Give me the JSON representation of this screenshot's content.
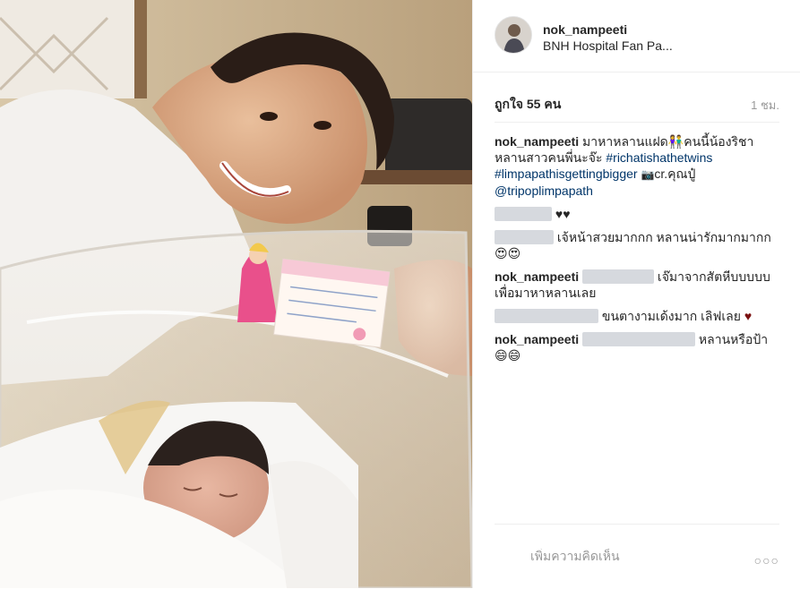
{
  "post": {
    "username": "nok_nampeeti",
    "location": "BNH Hospital Fan Pa...",
    "likes": "ถูกใจ 55 คน",
    "time_ago": "1 ชม."
  },
  "caption": {
    "user": "nok_nampeeti",
    "text_1": "มาหาหลานแฝด",
    "family_emoji": "👫",
    "text_2": "คนนี้น้องริชา หลานสาวคนพี่นะจ๊ะ",
    "hashtag_1": "#richatishathetwins",
    "hashtag_2": "#limpapathisgettingbigger",
    "camera_emoji": "📷",
    "credit": "cr.คุณปู๋",
    "mention": "@tripoplimpapath"
  },
  "comments": [
    {
      "text": "♥♥"
    },
    {
      "text": "เจ้หน้าสวยมากกก หลานน่ารักมากมากก😍😍"
    },
    {
      "user": "nok_nampeeti",
      "text": "เจ๊มาจากสัตหีบบบบบ เพื่อมาหาหลานเลย"
    },
    {
      "text": "ขนตางามเด้งมาก เลิฟเลย",
      "heart": "♥"
    },
    {
      "user": "nok_nampeeti",
      "text": "หลานหรือป้า😄😄"
    }
  ],
  "footer": {
    "comment_placeholder": "เพิ่มความคิดเห็น",
    "more_glyph": "○○○"
  },
  "icons": {
    "avatar": "avatar-photo",
    "more": "more-options-icon"
  },
  "colors": {
    "link": "#003569",
    "muted": "#999999",
    "text": "#262626"
  }
}
